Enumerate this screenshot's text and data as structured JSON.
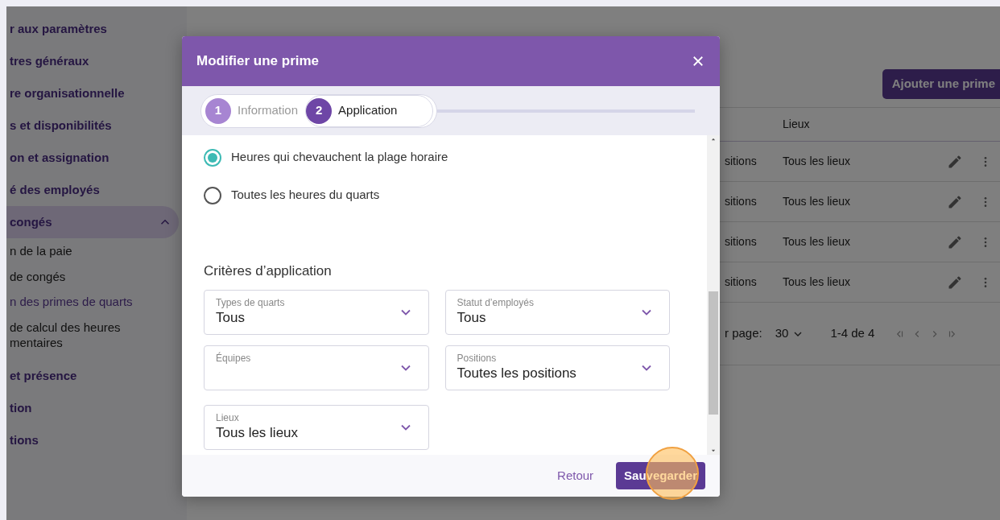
{
  "sidebar": {
    "items": [
      {
        "label": "r aux paramètres",
        "selected": false
      },
      {
        "label": "tres généraux",
        "selected": false
      },
      {
        "label": "re organisationnelle",
        "selected": false
      },
      {
        "label": "s et disponibilités",
        "selected": false
      },
      {
        "label": "on et assignation",
        "selected": false
      },
      {
        "label": "é des employés",
        "selected": false
      },
      {
        "label": "congés",
        "selected": true,
        "expanded": true,
        "children": [
          {
            "label": "n de la paie",
            "selected": false
          },
          {
            "label": "de congés",
            "selected": false
          },
          {
            "label": "n des primes de quarts",
            "selected": true
          },
          {
            "label": "de calcul des heures mentaires",
            "selected": false
          }
        ]
      },
      {
        "label": "et présence",
        "selected": false
      },
      {
        "label": "tion",
        "selected": false
      },
      {
        "label": "tions",
        "selected": false
      }
    ]
  },
  "main": {
    "add_button": "Ajouter une prime",
    "table": {
      "columns": [
        "Lieux"
      ],
      "rows": [
        {
          "column_1": "sitions",
          "lieux": "Tous les lieux"
        },
        {
          "column_1": "sitions",
          "lieux": "Tous les lieux"
        },
        {
          "column_1": "sitions",
          "lieux": "Tous les lieux"
        },
        {
          "column_1": "sitions",
          "lieux": "Tous les lieux"
        }
      ]
    },
    "pagination": {
      "label": "r page:",
      "per_page": "30",
      "range": "1-4 de 4"
    }
  },
  "modal": {
    "title": "Modifier une prime",
    "steps": [
      {
        "number": "1",
        "label": "Information",
        "selected": false
      },
      {
        "number": "2",
        "label": "Application",
        "selected": true
      }
    ],
    "options": [
      {
        "label": "Heures qui chevauchent la plage horaire",
        "checked": true
      },
      {
        "label": "Toutes les heures du quarts",
        "checked": false
      }
    ],
    "section_title": "Critères d’application",
    "fields": [
      {
        "label": "Types de quarts",
        "value": "Tous"
      },
      {
        "label": "Statut d’employés",
        "value": "Tous"
      },
      {
        "label": "Équipes"
      },
      {
        "label": "Positions",
        "value": "Toutes les positions"
      },
      {
        "label": "Lieux",
        "value": "Tous les lieux"
      }
    ],
    "back_button": "Retour",
    "save_button": "Sauvegarder"
  }
}
